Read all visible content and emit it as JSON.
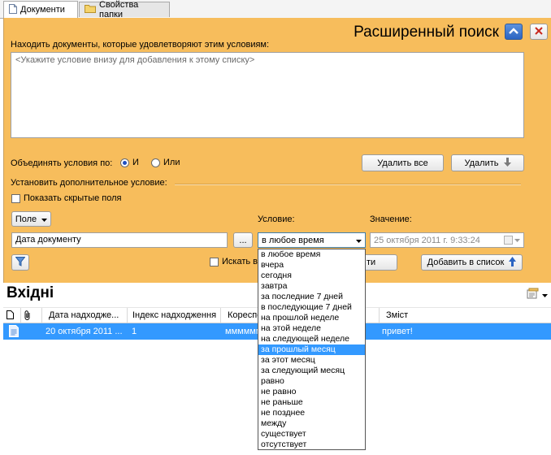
{
  "tabs": [
    {
      "label": "Документи",
      "active": true,
      "icon": "document-icon"
    },
    {
      "label": "Свойства папки",
      "active": false,
      "icon": "folder-icon"
    }
  ],
  "search": {
    "title": "Расширенный поиск",
    "find_label": "Находить документы, которые удовлетворяют этим условиям:",
    "conditions_placeholder": "<Укажите условие внизу для добавления к этому списку>",
    "combine_label": "Объединять условия по:",
    "and_label": "И",
    "or_label": "Или",
    "combine_selected": "И",
    "delete_all_label": "Удалить все",
    "delete_label": "Удалить",
    "additional_label": "Установить дополнительное условие:",
    "show_hidden_label": "Показать скрытые поля",
    "field_button_label": "Поле",
    "condition_label": "Условие:",
    "value_label": "Значение:",
    "field_value": "Дата документу",
    "browse_label": "...",
    "condition_value": "в любое время",
    "value_date": "25  октября  2011 г.   9:33:24",
    "search_in_label": "Искать в",
    "find_button_tail": "ти",
    "add_to_list_label": "Добавить в список"
  },
  "dropdown": {
    "options": [
      "в любое время",
      "вчера",
      "сегодня",
      "завтра",
      "за последние 7 дней",
      "в последующие 7 дней",
      "на прошлой неделе",
      "на этой неделе",
      "на следующей неделе",
      "за прошлый месяц",
      "за этот месяц",
      "за следующий месяц",
      "равно",
      "не равно",
      "не раньше",
      "не позднее",
      "между",
      "существует",
      "отсутствует"
    ],
    "highlighted": "за прошлый месяц"
  },
  "list": {
    "title": "Вхідні",
    "columns": [
      "",
      "",
      "Дата надходже...",
      "Індекс надходження",
      "Кореспо",
      "",
      "Зміст"
    ],
    "rows": [
      {
        "date": "20 октября 2011 ...",
        "index": "1",
        "correspondent": "мммммм",
        "content": "привет!"
      }
    ]
  },
  "colors": {
    "panel": "#f7bd5c",
    "selection": "#3399ff",
    "accent": "#1f64c8",
    "close": "#c8281e"
  }
}
